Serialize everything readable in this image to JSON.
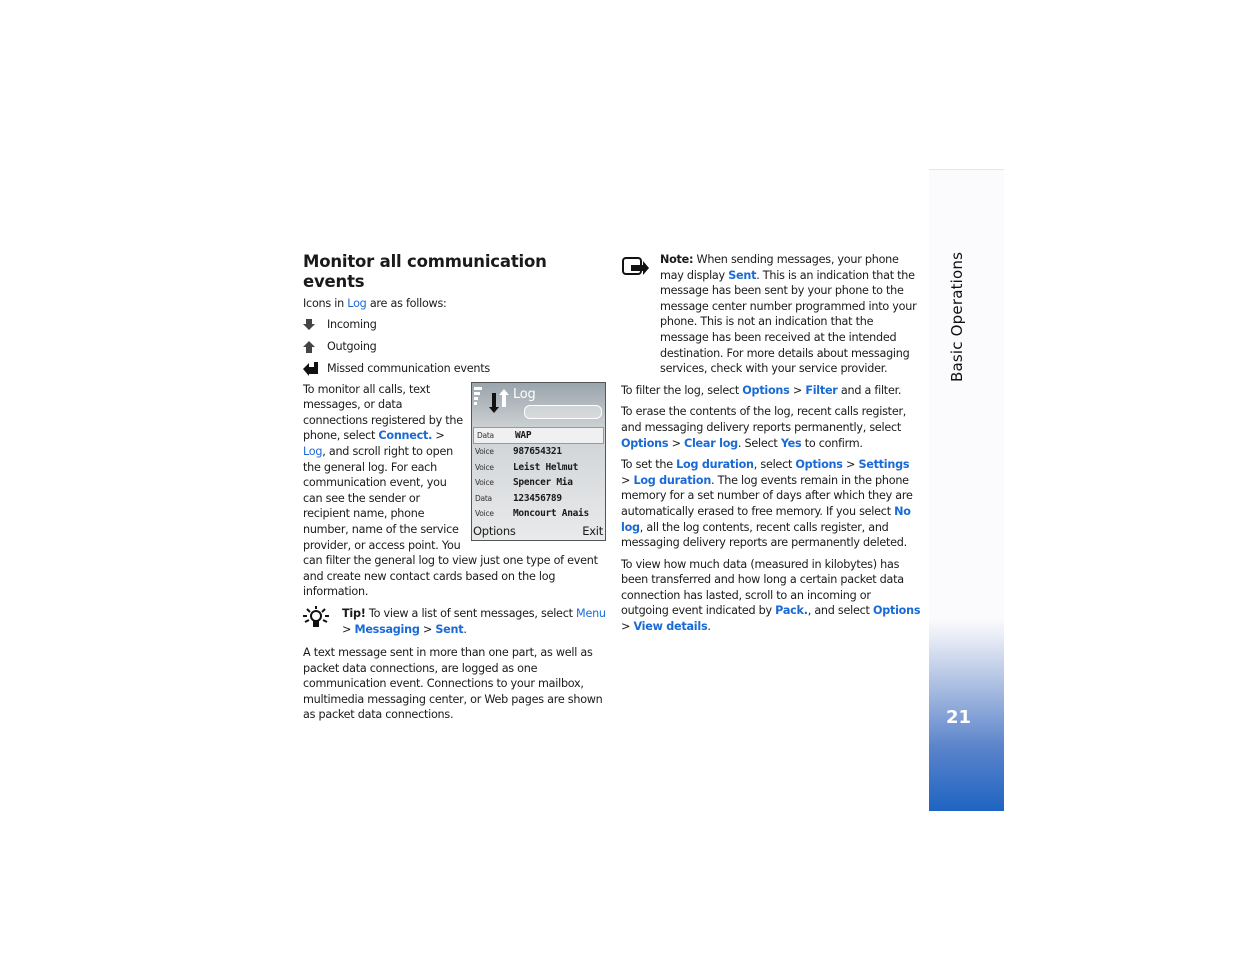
{
  "section_tab": "Basic Operations",
  "page_number": "21",
  "colors": {
    "link": "#1a6ad6",
    "sidebar_bottom": "#1e64c2"
  },
  "left": {
    "heading": "Monitor all communication events",
    "intro": {
      "pre": "Icons in ",
      "link": "Log",
      "post": " are as follows:"
    },
    "icons": [
      {
        "icon": "incoming-arrow-icon",
        "label": "Incoming"
      },
      {
        "icon": "outgoing-arrow-icon",
        "label": "Outgoing"
      },
      {
        "icon": "missed-event-icon",
        "label": "Missed communication events"
      }
    ],
    "para1": {
      "t1": "To monitor all calls, text messages, or data connections registered by the phone, select ",
      "l1": "Connect.",
      "t2": " > ",
      "l2": "Log",
      "t3": ", and scroll right to open the general log. For each communication event, you can see the sender or recipient name, phone number, name of the service provider, or access point. You can filter the general log to view just one type of event and create new contact cards based on the log information."
    },
    "tip": {
      "label": "Tip!",
      "t1": " To view a list of sent messages, select ",
      "l1": "Menu",
      "t2": " > ",
      "l2": "Messaging",
      "t3": " > ",
      "l3": "Sent",
      "t4": "."
    },
    "para2": "A text message sent in more than one part, as well as packet data connections, are logged as one communication event. Connections to your mailbox, multimedia messaging center, or Web pages are shown as packet data connections."
  },
  "phone_screen": {
    "title": "Log",
    "rows": [
      {
        "icon": "outgoing",
        "kind": "Data",
        "value": "WAP",
        "selected": true
      },
      {
        "icon": "incoming",
        "kind": "Voice",
        "value": "987654321"
      },
      {
        "icon": "outgoing",
        "kind": "Voice",
        "value": "Leist Helmut"
      },
      {
        "icon": "outgoing",
        "kind": "Voice",
        "value": "Spencer Mia"
      },
      {
        "icon": "outgoing",
        "kind": "Data",
        "value": "123456789"
      },
      {
        "icon": "outgoing",
        "kind": "Voice",
        "value": "Moncourt Anais"
      }
    ],
    "left_softkey": "Options",
    "right_softkey": "Exit"
  },
  "right": {
    "note": {
      "label": "Note:",
      "t1": " When sending messages, your phone may display ",
      "l1": "Sent",
      "t2": ". This is an indication that the message has been sent by your phone to the message center number programmed into your phone. This is not an indication that the message has been received at the intended destination. For more details about messaging services, check with your service provider."
    },
    "filter": {
      "t1": "To filter the log, select ",
      "l1": "Options",
      "t2": " > ",
      "l2": "Filter",
      "t3": " and a filter."
    },
    "erase": {
      "t1": "To erase the contents of the log, recent calls register, and messaging delivery reports permanently, select ",
      "l1": "Options",
      "t2": " > ",
      "l2": "Clear log",
      "t3": ". Select ",
      "l3": "Yes",
      "t4": " to confirm."
    },
    "duration": {
      "t1": "To set the ",
      "l1": "Log duration",
      "t2": ", select ",
      "l2": "Options",
      "t3": " > ",
      "l3": "Settings",
      "t4": " > ",
      "l4": "Log duration",
      "t5": ". The log events remain in the phone memory for a set number of days after which they are automatically erased to free memory. If you select ",
      "l5": "No log",
      "t6": ", all the log contents, recent calls register, and messaging delivery reports are permanently deleted."
    },
    "data": {
      "t1": "To view how much data (measured in kilobytes) has been transferred and how long a certain packet data connection has lasted, scroll to an incoming or outgoing event indicated by ",
      "l1": "Pack.",
      "t2": ", and select ",
      "l2": "Options",
      "t3": " > ",
      "l3": "View details",
      "t4": "."
    }
  }
}
